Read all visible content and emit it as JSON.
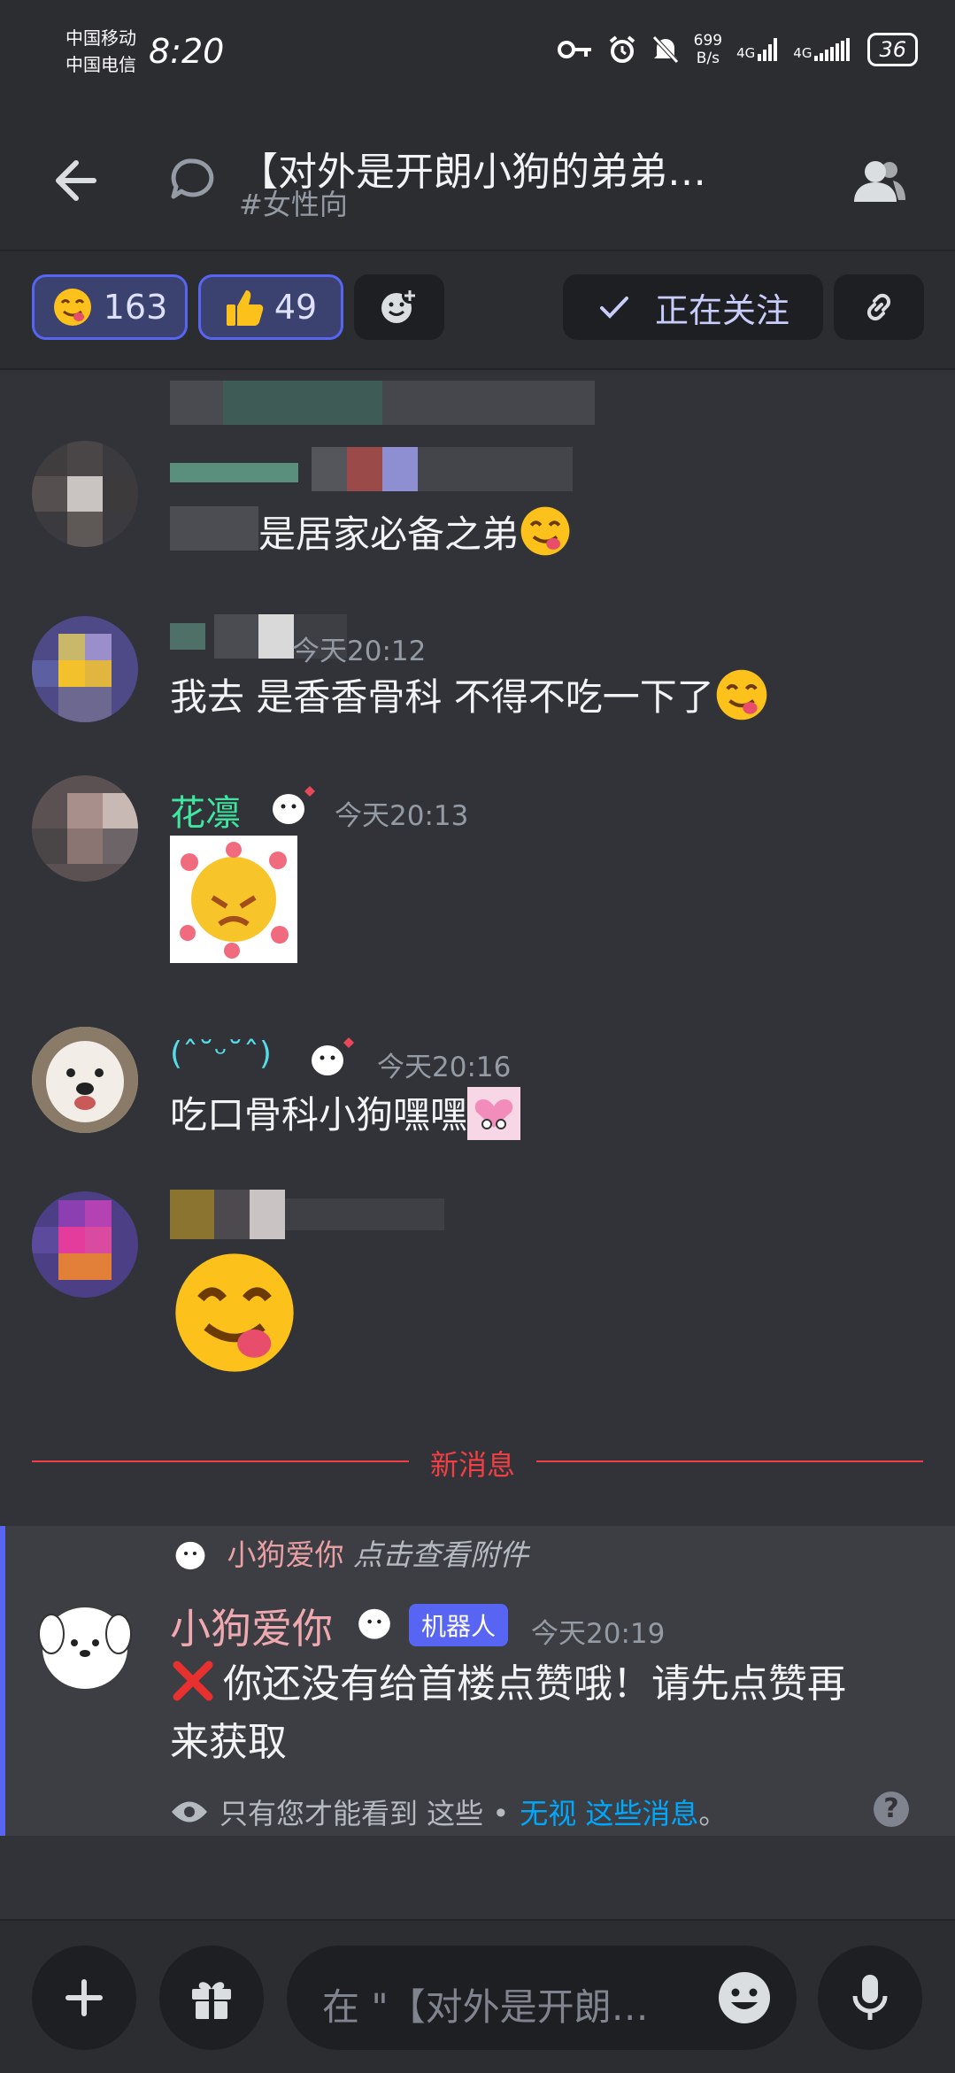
{
  "status_bar": {
    "carrier_1": "中国移动",
    "carrier_2": "中国电信",
    "time": "8:20",
    "net_speed_value": "699",
    "net_speed_unit": "B/s",
    "network_1": "4G",
    "network_2": "4G",
    "battery": "36"
  },
  "header": {
    "title": "【对外是开朗小狗的弟弟…",
    "subtitle": "#女性向"
  },
  "reactions": [
    {
      "emoji": "yum",
      "count": "163",
      "selected": true
    },
    {
      "emoji": "thumbs-up",
      "count": "49",
      "selected": true
    }
  ],
  "follow_button": {
    "label": "正在关注"
  },
  "messages": [
    {
      "text": "是居家必备之弟"
    },
    {
      "time": "今天20:12",
      "text": "我去 是香香骨科 不得不吃一下了"
    },
    {
      "author": "花凛",
      "author_color": "#3ee6a1",
      "time": "今天20:13"
    },
    {
      "author": "(ˆ˘ᵕ˘ˆ)",
      "author_color": "#56dbe8",
      "time": "今天20:16",
      "text": "吃口骨科小狗嘿嘿"
    },
    {
      "big_emoji": "yum"
    }
  ],
  "new_messages_label": "新消息",
  "ephemeral": {
    "reply_author": "小狗爱你",
    "reply_hint": "点击查看附件",
    "author": "小狗爱你",
    "author_color": "#f0a9b0",
    "badge": "机器人",
    "time": "今天20:19",
    "text_line1": "你还没有给首楼点赞哦！请先点赞再",
    "text_line2": "来获取",
    "footer_text": "只有您才能看到 这些 •",
    "footer_link": "无视 这些消息",
    "footer_end": "。",
    "help": "?"
  },
  "composer": {
    "placeholder": "在 \"【对外是开朗小狗的弟弟…"
  },
  "colors": {
    "accent": "#5865f2",
    "danger": "#f23f43",
    "link": "#00a8fc",
    "background": "#313338"
  }
}
